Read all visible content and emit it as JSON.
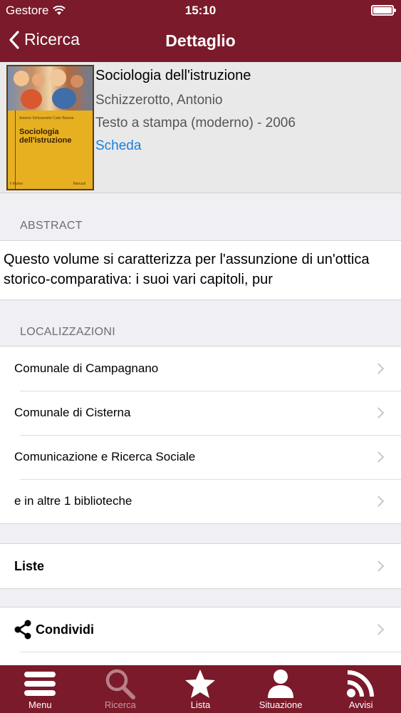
{
  "status_bar": {
    "carrier": "Gestore",
    "time": "15:10"
  },
  "nav": {
    "back_label": "Ricerca",
    "title": "Dettaglio"
  },
  "book": {
    "title": "Sociologia dell'istruzione",
    "author": "Schizzerotto, Antonio",
    "type_year": "Testo a stampa (moderno) - 2006",
    "link": "Scheda",
    "cover": {
      "authors_line": "Antonio Schizzerotto  Carlo Barone",
      "title": "Sociologia dell'istruzione",
      "publisher": "il Mulino",
      "series": "Manuali"
    }
  },
  "abstract": {
    "label": "ABSTRACT",
    "text": "Questo volume si caratterizza per l'assunzione di un'ottica storico-comparativa: i suoi vari capitoli, pur"
  },
  "locations": {
    "label": "LOCALIZZAZIONI",
    "items": [
      "Comunale di Campagnano",
      "Comunale di Cisterna",
      "Comunicazione e Ricerca Sociale",
      "e in altre 1 biblioteche"
    ]
  },
  "lists_row": {
    "label": "Liste"
  },
  "share_row": {
    "label": "Condividi"
  },
  "tabs": [
    {
      "label": "Menu",
      "icon": "menu-icon"
    },
    {
      "label": "Ricerca",
      "icon": "search-icon"
    },
    {
      "label": "Lista",
      "icon": "star-icon"
    },
    {
      "label": "Situazione",
      "icon": "user-icon"
    },
    {
      "label": "Avvisi",
      "icon": "rss-icon"
    }
  ],
  "colors": {
    "brand": "#7a1a2a",
    "link": "#1a7fe0",
    "background": "#efeff4"
  }
}
